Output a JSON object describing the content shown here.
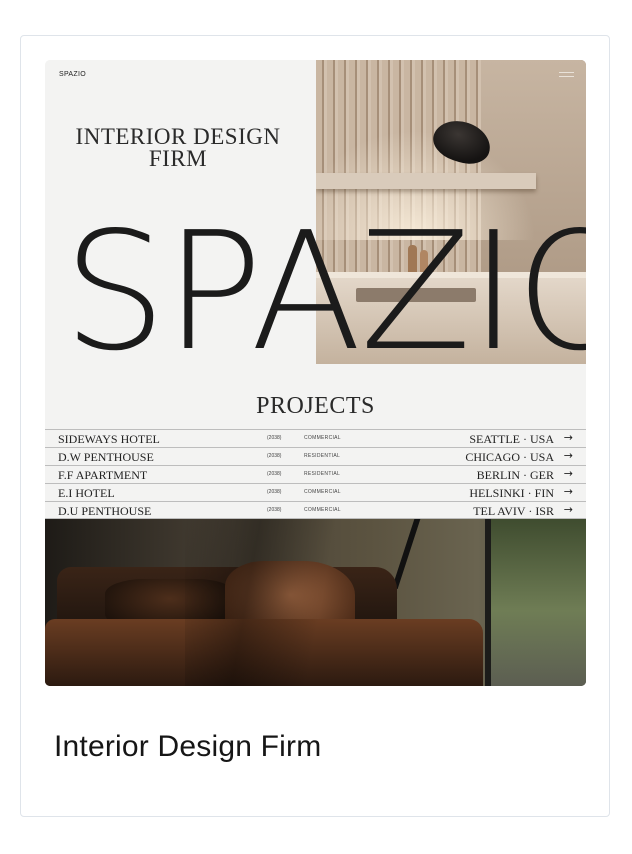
{
  "card": {
    "title": "Interior Design Firm"
  },
  "preview": {
    "logo": "SPAZIO",
    "subtitle_line1": "INTERIOR DESIGN",
    "subtitle_line2": "FIRM",
    "big_word": "SPAZIO",
    "projects_heading": "PROJECTS",
    "projects": [
      {
        "name": "SIDEWAYS HOTEL",
        "year": "(2038)",
        "type": "COMMERCIAL",
        "location": "SEATTLE · USA",
        "arrow": "→"
      },
      {
        "name": "D.W PENTHOUSE",
        "year": "(2038)",
        "type": "RESIDENTIAL",
        "location": "CHICAGO · USA",
        "arrow": "→"
      },
      {
        "name": "F.F APARTMENT",
        "year": "(2038)",
        "type": "RESIDENTIAL",
        "location": "BERLIN · GER",
        "arrow": "→"
      },
      {
        "name": "E.I HOTEL",
        "year": "(2038)",
        "type": "COMMERCIAL",
        "location": "HELSINKI · FIN",
        "arrow": "→"
      },
      {
        "name": "D.U PENTHOUSE",
        "year": "(2038)",
        "type": "COMMERCIAL",
        "location": "TEL AVIV · ISR",
        "arrow": "→"
      }
    ]
  },
  "icons": {
    "menu": "hamburger-menu-icon",
    "row_arrow": "arrow-right-icon"
  },
  "colors": {
    "text_dark": "#1b1b1b",
    "panel_bg": "#f3f3f2",
    "card_border": "#dfe4ea"
  }
}
